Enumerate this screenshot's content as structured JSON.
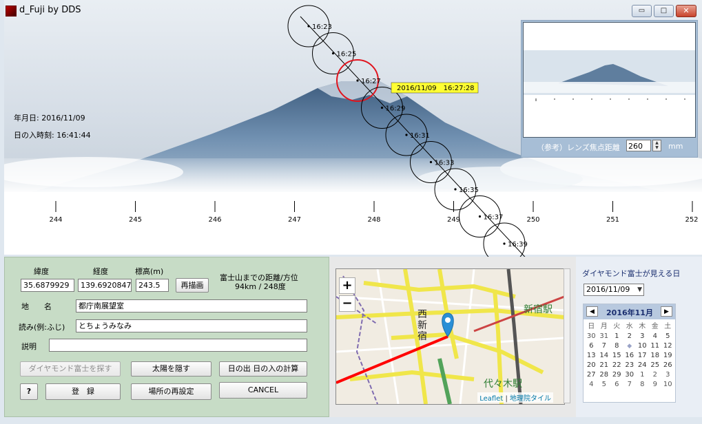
{
  "window": {
    "title": "d_Fuji  by DDS",
    "minimize_glyph": "▭",
    "maximize_glyph": "□",
    "close_glyph": "✕"
  },
  "scene": {
    "date_label": "年月日: 2016/11/09",
    "sunset_label": "日の入時刻: 16:41:44",
    "highlight_timestamp": "2016/11/09　16:27:28",
    "sun_labels": [
      "16:23",
      "16:25",
      "16:27",
      "16:29",
      "16:31",
      "16:33",
      "16:35",
      "16:37",
      "16:39"
    ],
    "azimuth_ticks": [
      "244",
      "245",
      "246",
      "247",
      "248",
      "249",
      "250",
      "251",
      "252"
    ]
  },
  "preview": {
    "lens_label": "（参考）レンズ焦点距離",
    "focal_length": "260",
    "unit": "mm"
  },
  "form": {
    "lat_label": "緯度",
    "lon_label": "経度",
    "alt_label": "標高(m)",
    "lat_value": "35.6879929",
    "lon_value": "139.6920847",
    "alt_value": "243.5",
    "redraw_button": "再描画",
    "distance_title": "富士山までの距離/方位",
    "distance_value": "94km  /  248度",
    "name_label": "地　　名",
    "name_value": "都庁南展望室",
    "reading_label": "読み(例:ふじ)",
    "reading_value": "とちょうみなみ",
    "description_label": "説明",
    "description_value": "",
    "find_diamond_button": "ダイヤモンド富士を探す",
    "hide_sun_button": "太陽を隠す",
    "sunrise_sunset_button": "日の出 日の入の計算",
    "help_button": "?",
    "register_button": "登　録",
    "reset_location_button": "場所の再設定",
    "cancel_button": "CANCEL"
  },
  "map": {
    "zoom_in": "+",
    "zoom_out": "−",
    "label_nishishinjuku": "西\n新\n宿",
    "label_shinjuku": "新宿駅",
    "label_yoyogi": "代々木駅",
    "attribution_leaflet": "Leaflet",
    "attribution_sep": " | ",
    "attribution_tiles": "地理院タイル"
  },
  "calendar": {
    "title": "ダイヤモンド富士が見える日",
    "selected_date": "2016/11/09",
    "month_label": "2016年11月",
    "prev": "◀",
    "next": "▶",
    "weekdays": [
      "日",
      "月",
      "火",
      "水",
      "木",
      "金",
      "土"
    ],
    "weeks": [
      [
        "30",
        "31",
        "1",
        "2",
        "3",
        "4",
        "5"
      ],
      [
        "6",
        "7",
        "8",
        "◆",
        "10",
        "11",
        "12"
      ],
      [
        "13",
        "14",
        "15",
        "16",
        "17",
        "18",
        "19"
      ],
      [
        "20",
        "21",
        "22",
        "23",
        "24",
        "25",
        "26"
      ],
      [
        "27",
        "28",
        "29",
        "30",
        "1",
        "2",
        "3"
      ],
      [
        "4",
        "5",
        "6",
        "7",
        "8",
        "9",
        "10"
      ]
    ]
  },
  "colors": {
    "sun_highlight": "#e0141e",
    "timestamp_bg": "#ffff33",
    "form_bg": "#c7dcc6",
    "route_red": "#ff0000",
    "map_pin": "#2a8fd6"
  }
}
